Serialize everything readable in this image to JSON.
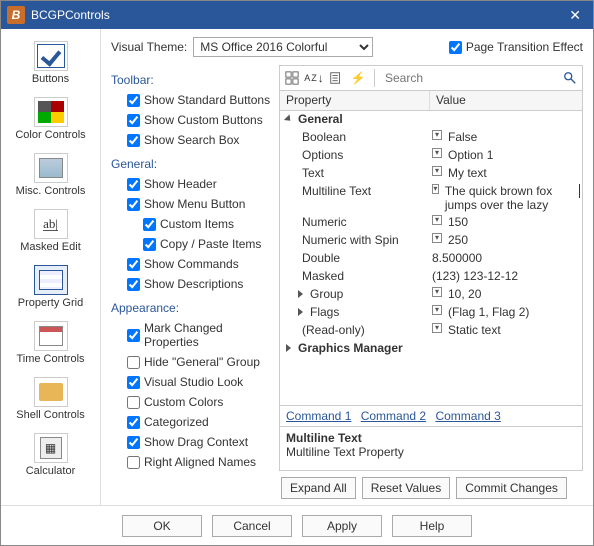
{
  "title": "BCGPControls",
  "theme_label": "Visual Theme:",
  "theme_value": "MS Office 2016 Colorful",
  "page_trans": "Page Transition Effect",
  "sidebar": [
    {
      "label": "Buttons"
    },
    {
      "label": "Color Controls"
    },
    {
      "label": "Misc. Controls"
    },
    {
      "label": "Masked Edit"
    },
    {
      "label": "Property Grid"
    },
    {
      "label": "Time Controls"
    },
    {
      "label": "Shell Controls"
    },
    {
      "label": "Calculator"
    }
  ],
  "sections": {
    "toolbar": "Toolbar:",
    "general": "General:",
    "appearance": "Appearance:"
  },
  "opts": {
    "std_btns": "Show Standard Buttons",
    "custom_btns": "Show Custom Buttons",
    "search_box": "Show Search Box",
    "header": "Show Header",
    "menu_btn": "Show Menu Button",
    "custom_items": "Custom Items",
    "copy_paste": "Copy / Paste Items",
    "commands": "Show Commands",
    "descriptions": "Show Descriptions",
    "mark_changed": "Mark Changed Properties",
    "hide_general": "Hide \"General\" Group",
    "vs_look": "Visual Studio Look",
    "custom_colors": "Custom Colors",
    "categorized": "Categorized",
    "drag_ctx": "Show Drag Context",
    "right_align": "Right Aligned Names"
  },
  "search_ph": "Search",
  "head": {
    "c1": "Property",
    "c2": "Value"
  },
  "groups": {
    "general": "General",
    "gm": "Graphics Manager"
  },
  "props": [
    {
      "n": "Boolean",
      "v": "False"
    },
    {
      "n": "Options",
      "v": "Option 1"
    },
    {
      "n": "Text",
      "v": "My text"
    },
    {
      "n": "Multiline Text",
      "v": "The quick brown fox jumps over the lazy"
    },
    {
      "n": "Numeric",
      "v": "150"
    },
    {
      "n": "Numeric with Spin",
      "v": "250"
    },
    {
      "n": "Double",
      "v": "8.500000"
    },
    {
      "n": "Masked",
      "v": "(123) 123-12-12"
    },
    {
      "n": "Group",
      "v": "10, 20"
    },
    {
      "n": "Flags",
      "v": "(Flag 1, Flag 2)"
    },
    {
      "n": "(Read-only)",
      "v": "Static text"
    }
  ],
  "links": [
    "Command 1",
    "Command 2",
    "Command 3"
  ],
  "desc": {
    "title": "Multiline Text",
    "body": "Multiline Text Property"
  },
  "gridbtns": {
    "exp": "Expand All",
    "reset": "Reset Values",
    "commit": "Commit Changes"
  },
  "footer": {
    "ok": "OK",
    "cancel": "Cancel",
    "apply": "Apply",
    "help": "Help"
  }
}
